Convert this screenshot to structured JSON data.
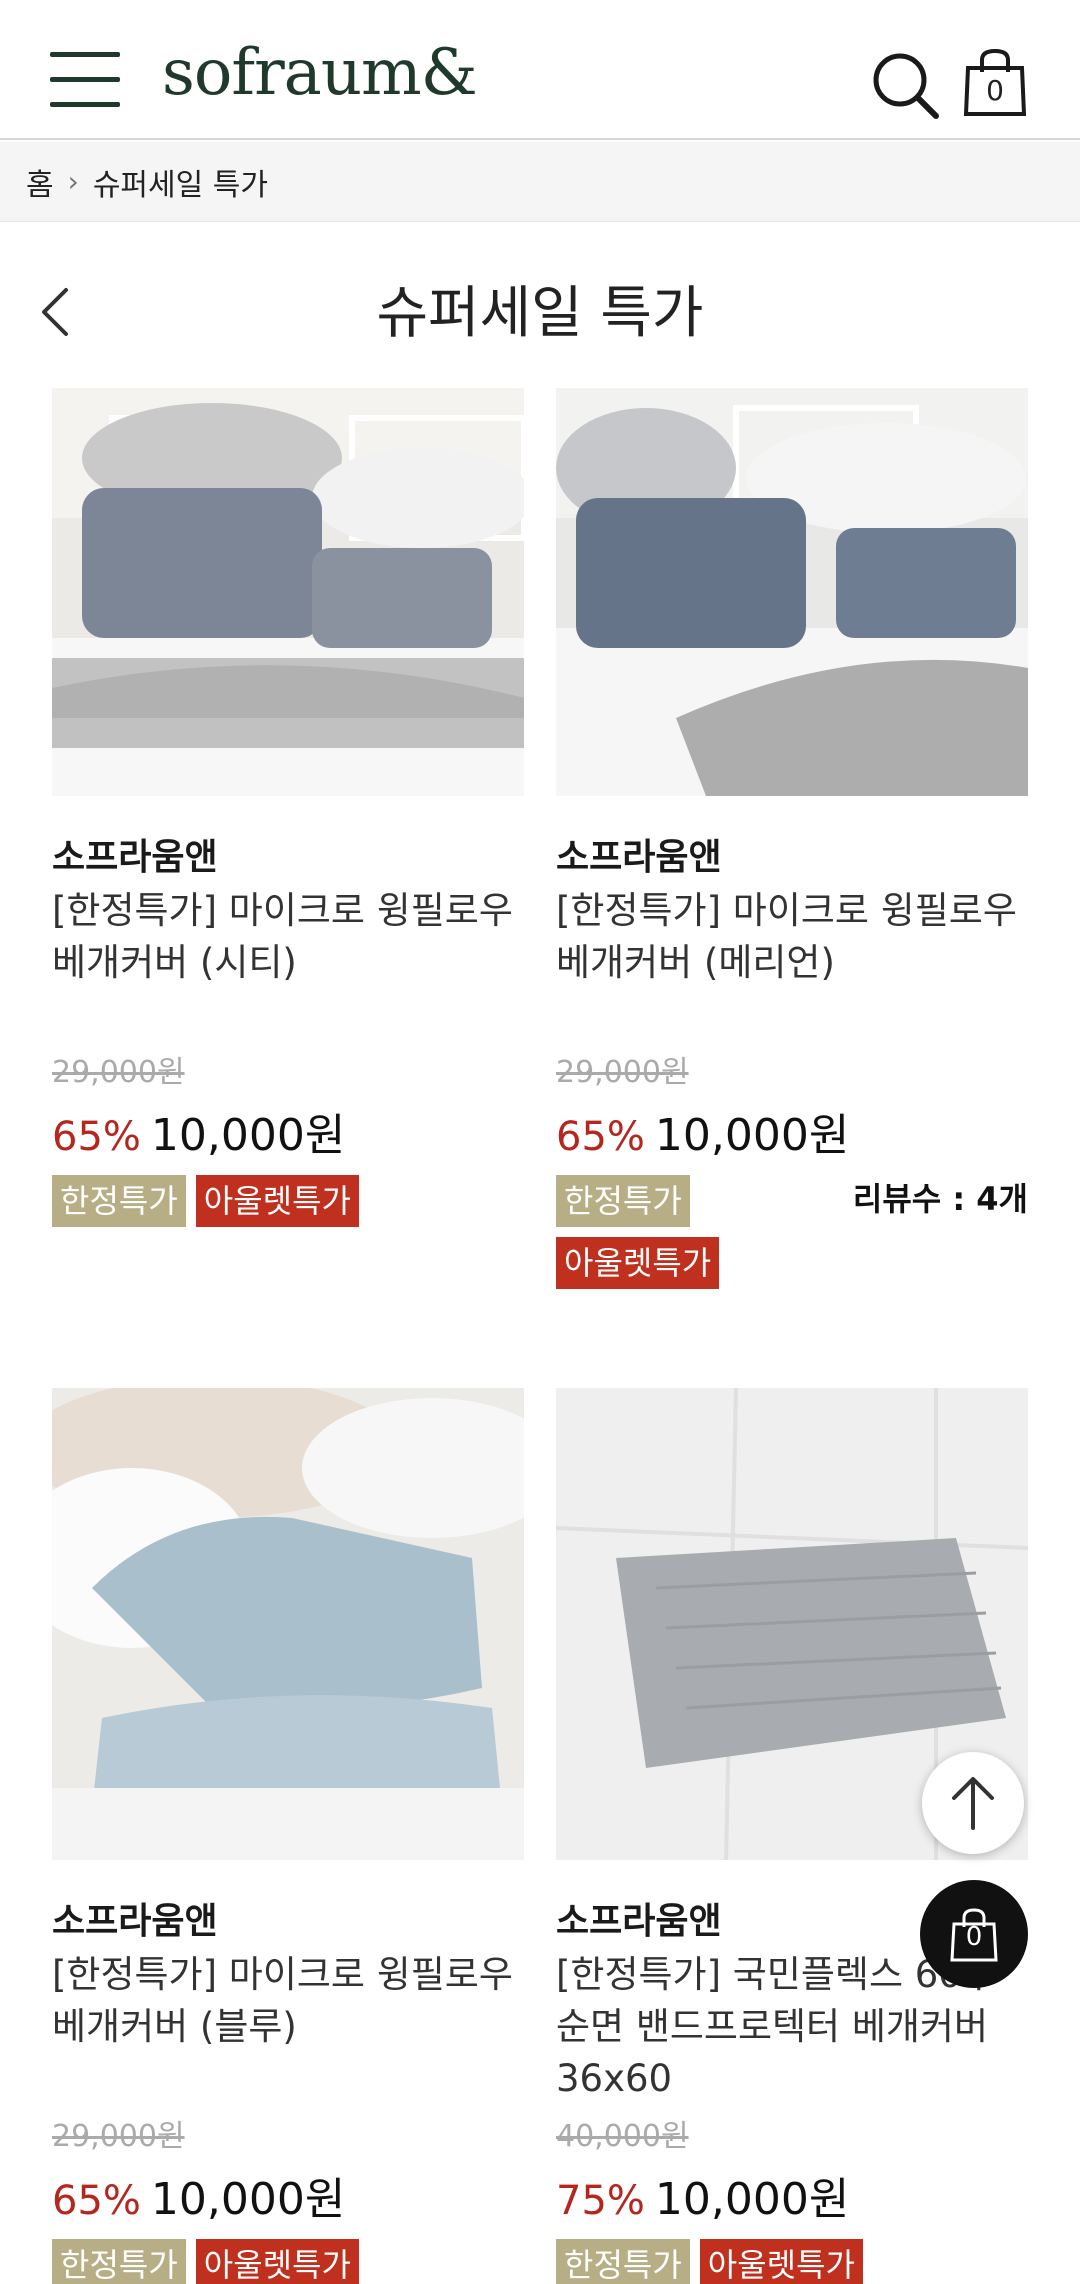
{
  "header": {
    "logo": "sofraum&",
    "cart_count": "0"
  },
  "breadcrumb": {
    "home": "홈",
    "current": "슈퍼세일 특가"
  },
  "page_title": "슈퍼세일 특가",
  "products": [
    {
      "brand": "소프라움앤",
      "name": "[한정특가] 마이크로 윙필로우 베개커버 (시티)",
      "old_price": "29,000원",
      "discount": "65%",
      "price": "10,000원",
      "badges": [
        "한정특가",
        "아울렛특가"
      ],
      "reviews": ""
    },
    {
      "brand": "소프라움앤",
      "name": "[한정특가] 마이크로 윙필로우 베개커버 (메리언)",
      "old_price": "29,000원",
      "discount": "65%",
      "price": "10,000원",
      "badges": [
        "한정특가",
        "아울렛특가"
      ],
      "reviews": "리뷰수 : 4개"
    },
    {
      "brand": "소프라움앤",
      "name": "[한정특가] 마이크로 윙필로우 베개커버 (블루)",
      "old_price": "29,000원",
      "discount": "65%",
      "price": "10,000원",
      "badges": [
        "한정특가",
        "아울렛특가"
      ],
      "reviews": ""
    },
    {
      "brand": "소프라움앤",
      "name": "[한정특가] 국민플렉스 60수 순면 밴드프로텍터 베개커버 36x60",
      "old_price": "40,000원",
      "discount": "75%",
      "price": "10,000원",
      "badges": [
        "한정특가",
        "아울렛특가"
      ],
      "reviews": ""
    }
  ],
  "float_cart_count": "0"
}
